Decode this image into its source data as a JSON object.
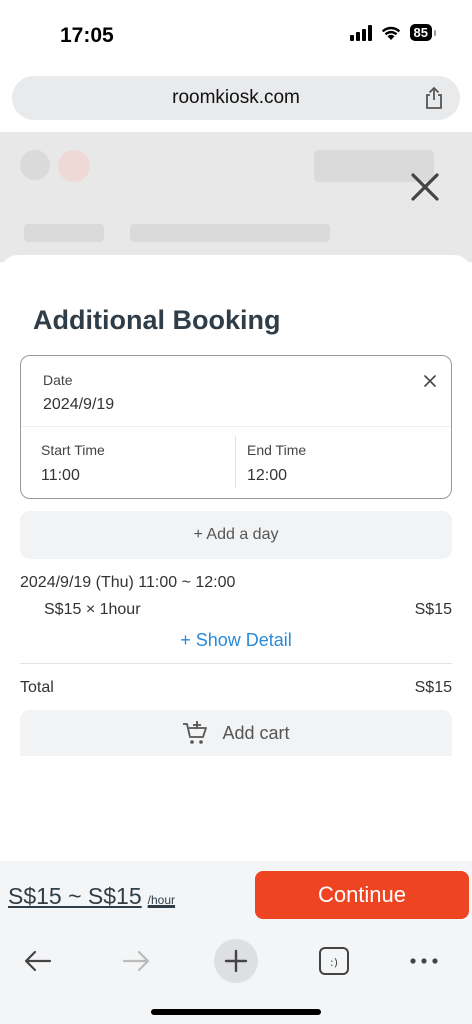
{
  "status": {
    "time": "17:05",
    "battery": "85"
  },
  "browser": {
    "url": "roomkiosk.com"
  },
  "sheet": {
    "title": "Additional Booking",
    "date_label": "Date",
    "date_value": "2024/9/19",
    "start_label": "Start Time",
    "start_value": "11:00",
    "end_label": "End Time",
    "end_value": "12:00",
    "add_day": "+ Add a day",
    "summary_date": "2024/9/19 (Thu) 11:00 ~ 12:00",
    "price_line": "S$15 × 1hour",
    "price_line_total": "S$15",
    "show_detail": "+ Show Detail",
    "total_label": "Total",
    "total_value": "S$15",
    "add_cart": "Add cart"
  },
  "footer": {
    "price_range": "S$15 ~ S$15",
    "per_hour": "/hour",
    "continue": "Continue"
  },
  "colors": {
    "accent": "#ee4422",
    "link": "#2a8ad8",
    "title": "#2f3d48"
  },
  "icons": [
    "share-icon",
    "close-icon",
    "cart-icon",
    "back-arrow-icon",
    "forward-arrow-icon",
    "plus-icon",
    "tabs-icon",
    "more-icon"
  ]
}
